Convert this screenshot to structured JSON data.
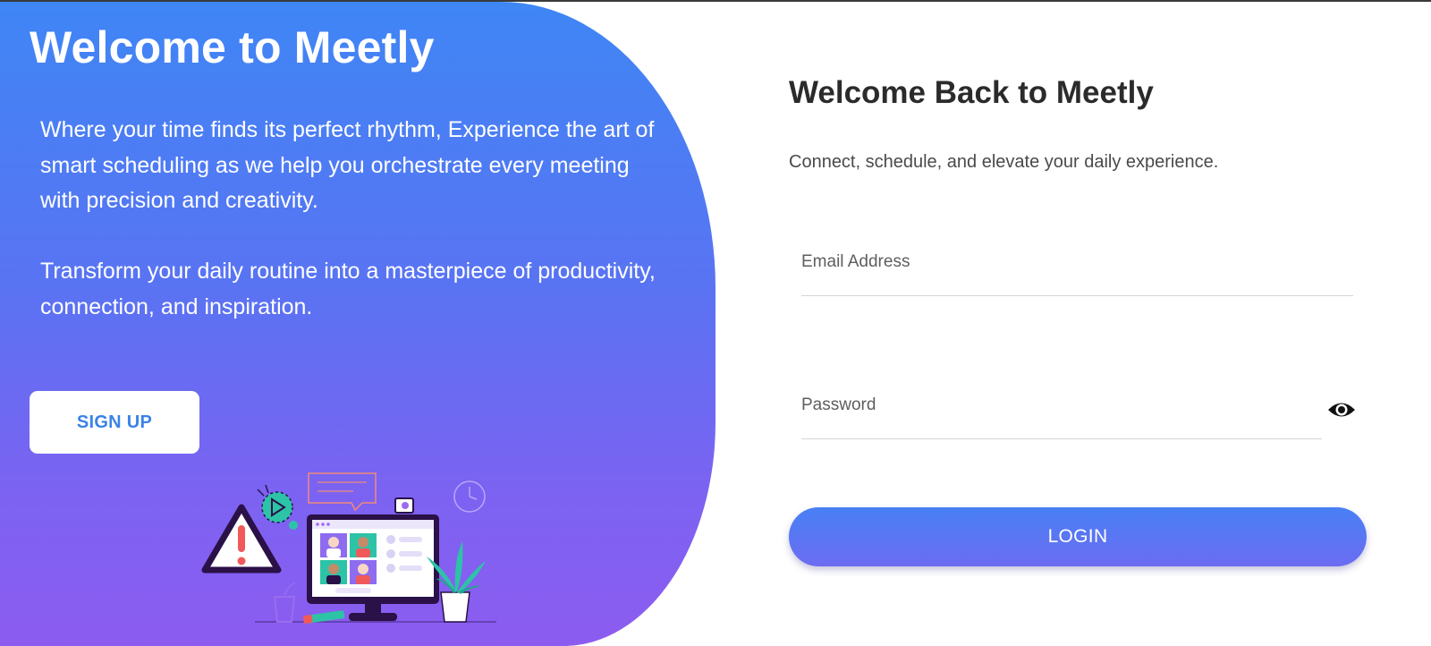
{
  "hero": {
    "title": "Welcome to Meetly",
    "paragraph1": "Where your time finds its perfect rhythm, Experience the art of smart scheduling as we help you orchestrate every meeting with precision and creativity.",
    "paragraph2": "Transform your daily routine into a masterpiece of productivity, connection, and inspiration.",
    "signup_label": "SIGN UP",
    "gradient_top": "#3f86f5",
    "gradient_bottom": "#8c5cf0"
  },
  "login": {
    "title": "Welcome Back to Meetly",
    "subtitle": "Connect, schedule, and elevate your daily experience.",
    "email_placeholder": "Email Address",
    "password_placeholder": "Password",
    "password_toggle_icon": "eye-icon",
    "login_label": "LOGIN"
  },
  "illustration": {
    "icons": [
      "warning-icon",
      "play-icon",
      "chat-bubble-icon",
      "camera-icon",
      "clock-icon",
      "monitor-icon",
      "plant-icon",
      "pencil-icon",
      "cup-icon"
    ]
  },
  "colors": {
    "accent_blue": "#3b82e6",
    "title_dark": "#2b2b2b",
    "warning_red": "#f05a5a"
  }
}
